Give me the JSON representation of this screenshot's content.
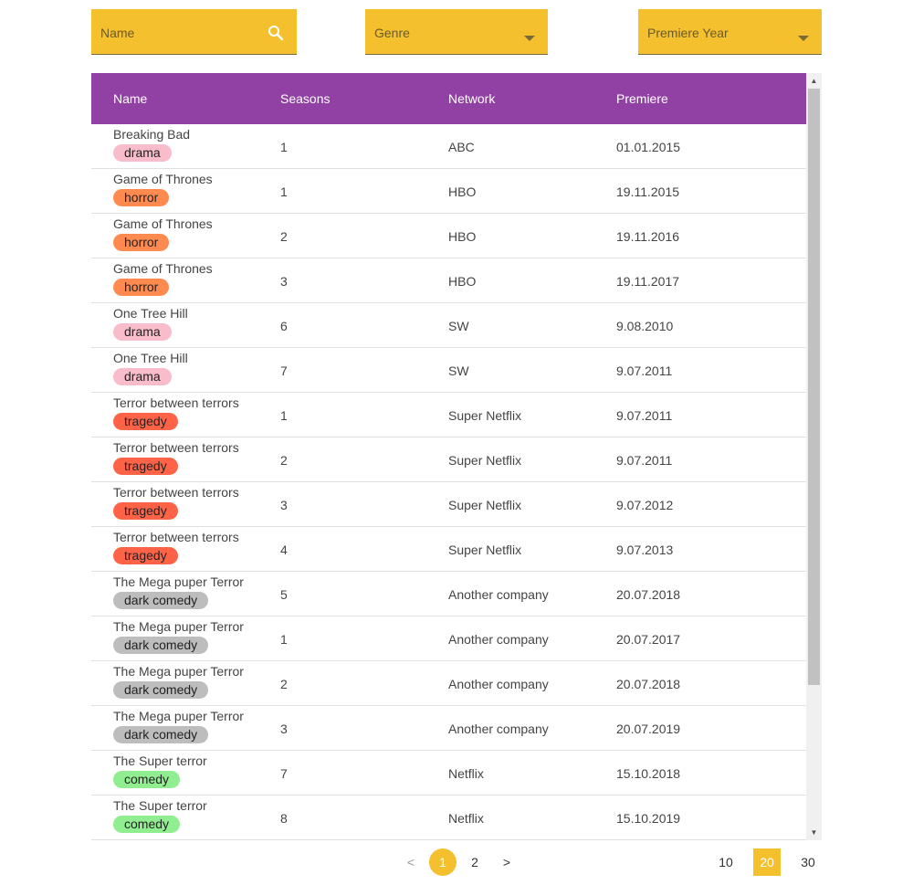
{
  "filters": {
    "name": {
      "label": "Name",
      "icon": "search-icon"
    },
    "genre": {
      "label": "Genre",
      "icon": "dropdown-arrow-icon"
    },
    "premiere_year": {
      "label": "Premiere Year",
      "icon": "dropdown-arrow-icon"
    }
  },
  "table": {
    "headers": {
      "name": "Name",
      "seasons": "Seasons",
      "network": "Network",
      "premiere": "Premiere"
    },
    "rows": [
      {
        "name": "Breaking Bad",
        "genre": "drama",
        "seasons": "1",
        "network": "ABC",
        "premiere": "01.01.2015"
      },
      {
        "name": "Game of Thrones",
        "genre": "horror",
        "seasons": "1",
        "network": "HBO",
        "premiere": "19.11.2015"
      },
      {
        "name": "Game of Thrones",
        "genre": "horror",
        "seasons": "2",
        "network": "HBO",
        "premiere": "19.11.2016"
      },
      {
        "name": "Game of Thrones",
        "genre": "horror",
        "seasons": "3",
        "network": "HBO",
        "premiere": "19.11.2017"
      },
      {
        "name": "One Tree Hill",
        "genre": "drama",
        "seasons": "6",
        "network": "SW",
        "premiere": "9.08.2010"
      },
      {
        "name": "One Tree Hill",
        "genre": "drama",
        "seasons": "7",
        "network": "SW",
        "premiere": "9.07.2011"
      },
      {
        "name": "Terror between terrors",
        "genre": "tragedy",
        "seasons": "1",
        "network": "Super Netflix",
        "premiere": "9.07.2011"
      },
      {
        "name": "Terror between terrors",
        "genre": "tragedy",
        "seasons": "2",
        "network": "Super Netflix",
        "premiere": "9.07.2011"
      },
      {
        "name": "Terror between terrors",
        "genre": "tragedy",
        "seasons": "3",
        "network": "Super Netflix",
        "premiere": "9.07.2012"
      },
      {
        "name": "Terror between terrors",
        "genre": "tragedy",
        "seasons": "4",
        "network": "Super Netflix",
        "premiere": "9.07.2013"
      },
      {
        "name": "The Mega puper Terror",
        "genre": "dark comedy",
        "seasons": "5",
        "network": "Another company",
        "premiere": "20.07.2018"
      },
      {
        "name": "The Mega puper Terror",
        "genre": "dark comedy",
        "seasons": "1",
        "network": "Another company",
        "premiere": "20.07.2017"
      },
      {
        "name": "The Mega puper Terror",
        "genre": "dark comedy",
        "seasons": "2",
        "network": "Another company",
        "premiere": "20.07.2018"
      },
      {
        "name": "The Mega puper Terror",
        "genre": "dark comedy",
        "seasons": "3",
        "network": "Another company",
        "premiere": "20.07.2019"
      },
      {
        "name": "The Super terror",
        "genre": "comedy",
        "seasons": "7",
        "network": "Netflix",
        "premiere": "15.10.2018"
      },
      {
        "name": "The Super terror",
        "genre": "comedy",
        "seasons": "8",
        "network": "Netflix",
        "premiere": "15.10.2019"
      }
    ]
  },
  "genre_colors": {
    "drama": "#f8bccb",
    "horror": "#ff8a50",
    "tragedy": "#ff6347",
    "dark comedy": "#bdbdbd",
    "comedy": "#90ee90"
  },
  "pagination": {
    "prev": "<",
    "next": ">",
    "pages": [
      "1",
      "2"
    ],
    "current_page": "1",
    "page_sizes": [
      "10",
      "20",
      "30"
    ],
    "current_page_size": "20"
  },
  "colors": {
    "accent": "#f5c02e",
    "header": "#9141a3"
  }
}
